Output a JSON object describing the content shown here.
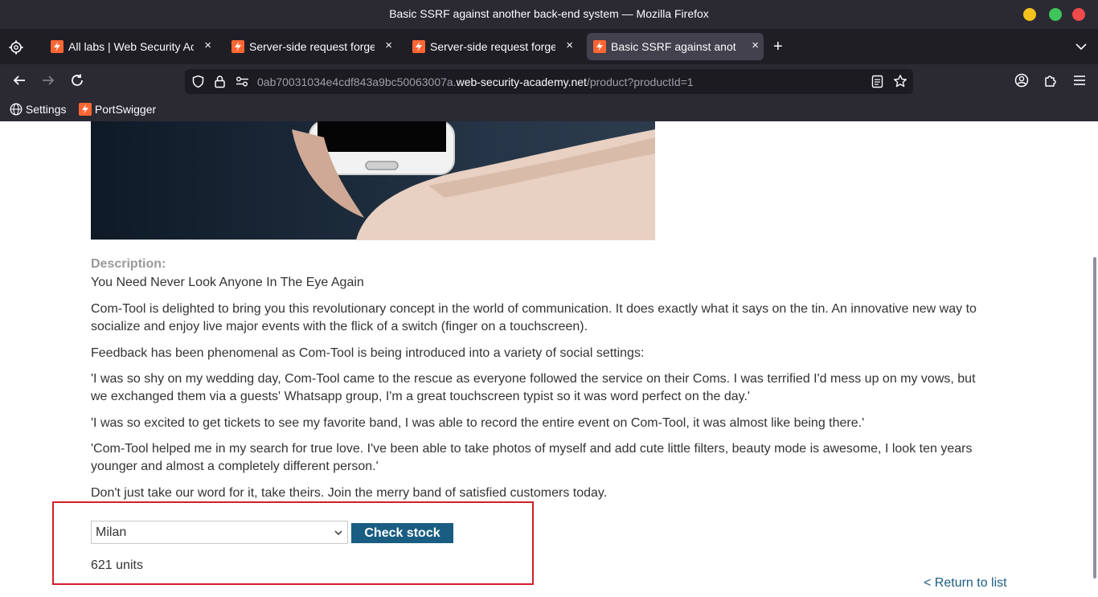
{
  "window": {
    "title": "Basic SSRF against another back-end system — Mozilla Firefox"
  },
  "tabs": [
    {
      "label": "All labs | Web Security Academy",
      "active": false
    },
    {
      "label": "Server-side request forgery",
      "active": false
    },
    {
      "label": "Server-side request forgery",
      "active": false
    },
    {
      "label": "Basic SSRF against another back-end system",
      "active": true
    }
  ],
  "tab_close_glyph": "×",
  "newtab_glyph": "+",
  "urlbar": {
    "url_subdomain": "0ab70031034e4cdf843a9bc50063007a.",
    "url_domain": "web-security-academy.net",
    "url_path": "/product?productId=1"
  },
  "bookmarks": [
    {
      "label": "Settings",
      "icon": "globe-icon"
    },
    {
      "label": "PortSwigger",
      "icon": "portswigger-icon"
    }
  ],
  "product": {
    "description_label": "Description:",
    "paragraphs": [
      "You Need Never Look Anyone In The Eye Again",
      "Com-Tool is delighted to bring you this revolutionary concept in the world of communication. It does exactly what it says on the tin. An innovative new way to socialize and enjoy live major events with the flick of a switch (finger on a touchscreen).",
      "Feedback has been phenomenal as Com-Tool is being introduced into a variety of social settings:",
      "'I was so shy on my wedding day, Com-Tool came to the rescue as everyone followed the service on their Coms. I was terrified I'd mess up on my vows, but we exchanged them via a guests' Whatsapp group, I'm a great touchscreen typist so it was word perfect on the day.'",
      "'I was so excited to get tickets to see my favorite band, I was able to record the entire event on Com-Tool, it was almost like being there.'",
      "'Com-Tool helped me in my search for true love. I've been able to take photos of myself and add cute little filters, beauty mode is awesome, I look ten years younger and almost a completely different person.'",
      "Don't just take our word for it, take theirs. Join the merry band of satisfied customers today."
    ]
  },
  "stock": {
    "selected_store": "Milan",
    "check_button": "Check stock",
    "result": "621 units"
  },
  "return_link": "< Return to list",
  "colors": {
    "accent": "#1a5d82",
    "highlight_box": "#d0202a",
    "chrome_bg": "#2b2a33"
  }
}
